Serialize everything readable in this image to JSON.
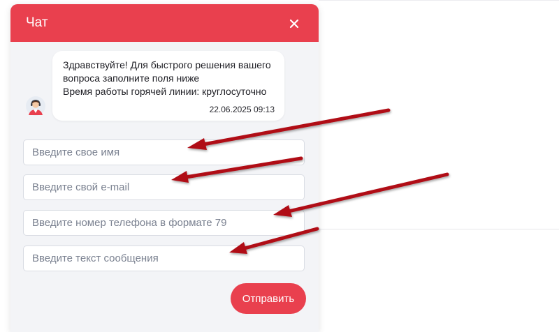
{
  "chat": {
    "title": "Чат",
    "close_icon": "close-icon",
    "message": {
      "text": "Здравствуйте! Для быстрого решения вашего вопроса заполните поля ниже\nВремя работы горячей линии: круглосуточно",
      "time": "22.06.2025 09:13",
      "avatar_icon": "operator-avatar-icon"
    },
    "form": {
      "name_placeholder": "Введите свое имя",
      "email_placeholder": "Введите свой e-mail",
      "phone_placeholder": "Введите номер телефона в формате 79",
      "message_placeholder": "Введите текст сообщения",
      "send_label": "Отправить"
    }
  },
  "colors": {
    "accent": "#e9404e",
    "annotation_arrow": "#b00a14",
    "panel_background": "#f3f4f7"
  }
}
